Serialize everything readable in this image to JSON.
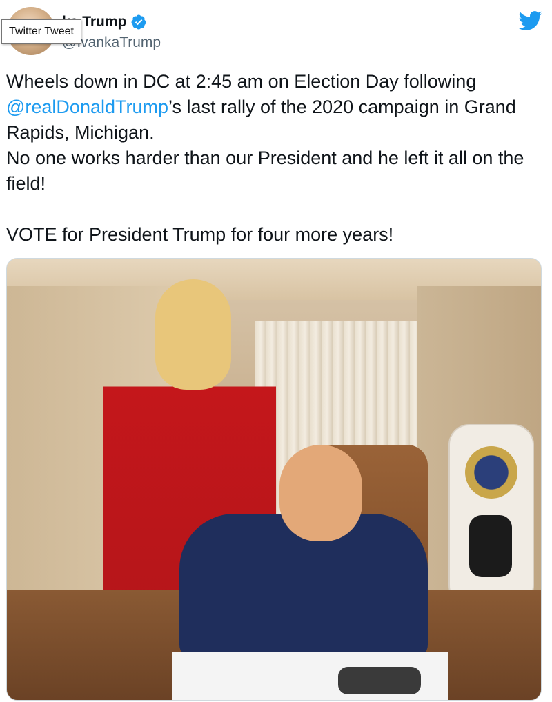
{
  "tooltip": {
    "text": "Twitter Tweet"
  },
  "author": {
    "display_name": "ka Trump",
    "handle": "@IvankaTrump",
    "verified": true
  },
  "icons": {
    "brand": "twitter-bird-icon",
    "verified": "verified-badge-icon"
  },
  "colors": {
    "link": "#1d9bf0",
    "text": "#0f1419",
    "secondary_text": "#536471",
    "verified": "#1d9bf0"
  },
  "tweet": {
    "line1_before_mention": "Wheels down in DC at 2:45 am on Election Day following ",
    "mention": "@realDonaldTrump",
    "line1_after_mention": "’s last rally of the 2020 campaign in Grand Rapids, Michigan.",
    "line2": "No one  works harder than our President and he left it all on the field!",
    "line3": "VOTE for President Trump for four more years!"
  }
}
